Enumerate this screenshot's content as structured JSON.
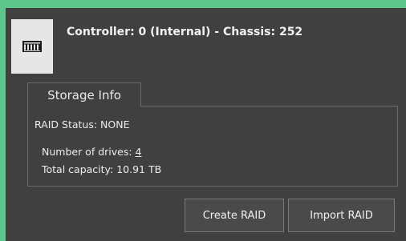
{
  "controller": {
    "title": "Controller: 0 (Internal) - Chassis: 252",
    "icon": "raid-controller-icon"
  },
  "tab": {
    "label": "Storage Info"
  },
  "storage": {
    "raid_status": "RAID Status: NONE",
    "drives_label": "Number of drives: ",
    "drives_count": "4",
    "capacity": "Total capacity: 10.91 TB"
  },
  "actions": {
    "create_label": "Create RAID",
    "import_label": "Import RAID"
  },
  "colors": {
    "background_accent": "#5dc68a",
    "panel": "#404040",
    "text": "#ececec"
  }
}
